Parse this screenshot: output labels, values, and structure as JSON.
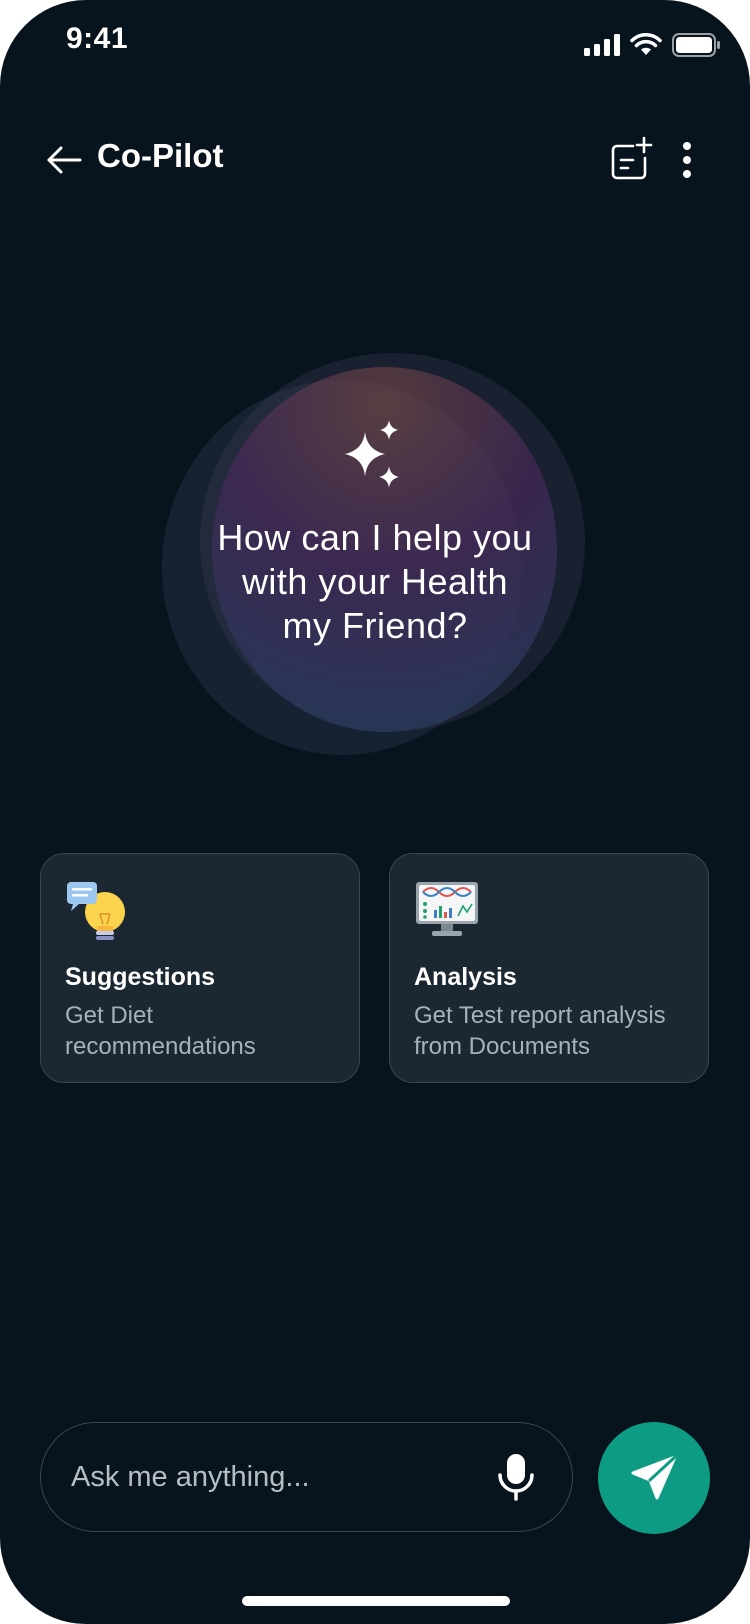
{
  "status_bar": {
    "time": "9:41"
  },
  "header": {
    "title": "Co-Pilot",
    "back_icon": "arrow-left-icon",
    "new_chat_icon": "new-chat-icon",
    "more_icon": "more-vertical-icon"
  },
  "hero": {
    "icon": "sparkle-icon",
    "line1": "How can I help you",
    "line2": "with your Health",
    "line3": "my Friend?"
  },
  "cards": [
    {
      "icon": "lightbulb-chat-icon",
      "title": "Suggestions",
      "line1": "Get Diet",
      "line2": "recommendations"
    },
    {
      "icon": "dna-monitor-icon",
      "title": "Analysis",
      "line1": "Get Test report analysis",
      "line2": "from Documents"
    }
  ],
  "composer": {
    "placeholder": "Ask me anything...",
    "mic_icon": "microphone-icon",
    "send_icon": "send-icon"
  },
  "colors": {
    "background": "#07131d",
    "card": "#1b2731",
    "accent": "#0d9b83"
  }
}
